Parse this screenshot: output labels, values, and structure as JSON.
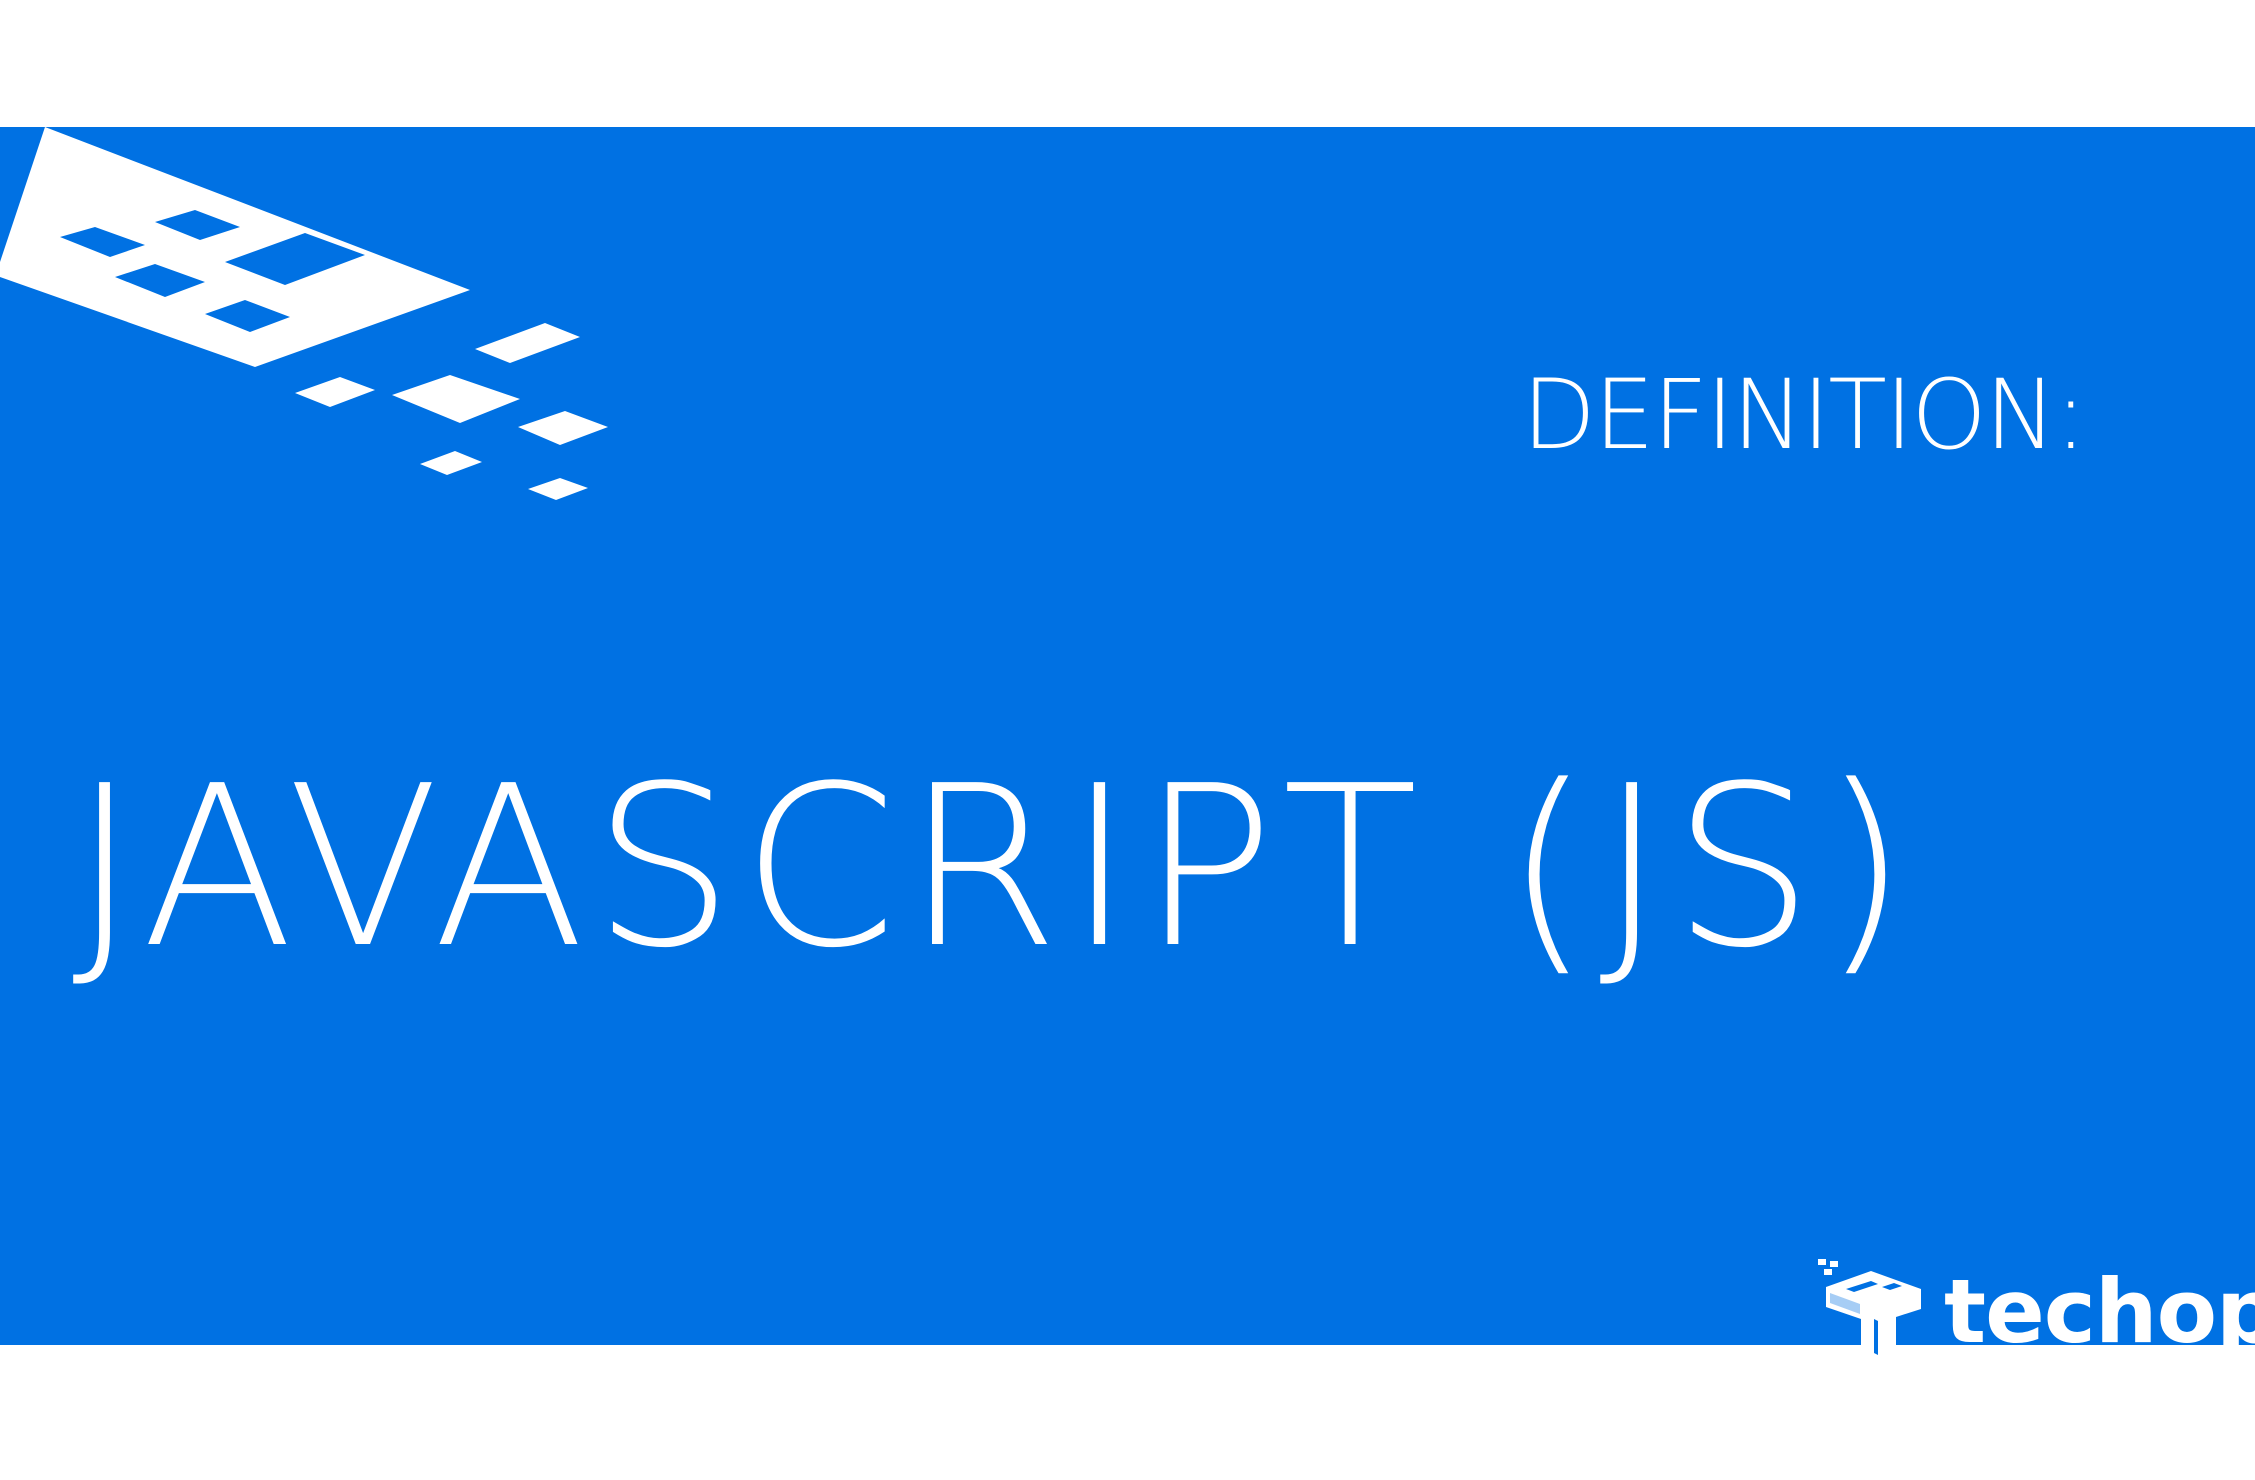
{
  "banner": {
    "background_color": "#0071e3",
    "text_color": "#ffffff",
    "heading": "DEFINITION:",
    "term": "JAVASCRIPT (JS)"
  },
  "decoration": {
    "icon": "isometric-grid-pixels-icon"
  },
  "logo": {
    "icon": "techopedia-t-cube-icon",
    "wordmark": "techope"
  }
}
